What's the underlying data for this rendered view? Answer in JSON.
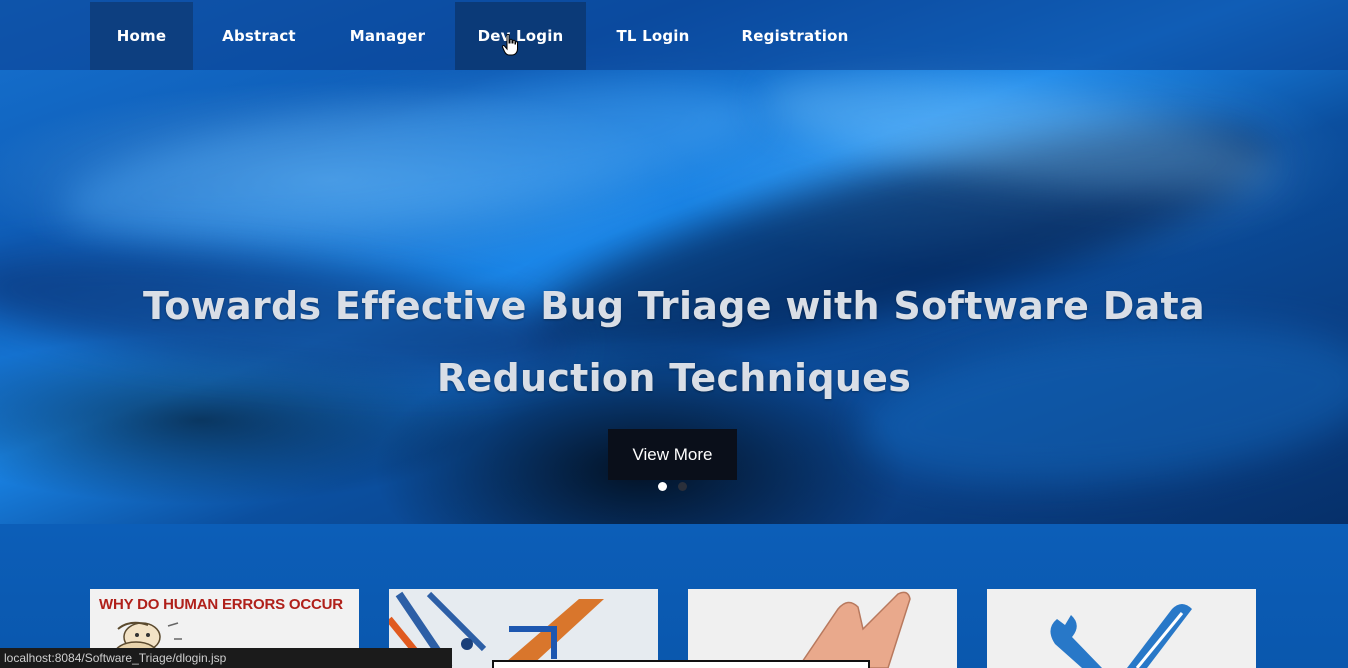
{
  "nav": {
    "items": [
      {
        "label": "Home"
      },
      {
        "label": "Abstract"
      },
      {
        "label": "Manager"
      },
      {
        "label": "Dev Login"
      },
      {
        "label": "TL Login"
      },
      {
        "label": "Registration"
      }
    ]
  },
  "hero": {
    "title": "Towards Effective Bug Triage with Software Data Reduction Techniques",
    "button_label": "View More",
    "slides": {
      "total": 2,
      "active": 1
    }
  },
  "cards": [
    {
      "caption": "WHY DO HUMAN ERRORS OCCUR"
    },
    {
      "caption": ""
    },
    {
      "caption": ""
    },
    {
      "caption": ""
    }
  ],
  "statusbar": {
    "url": "localhost:8084/Software_Triage/dlogin.jsp"
  },
  "colors": {
    "nav_active": "#0d3f80",
    "hero_blue": "#1672d0",
    "button_bg": "#0a0f1a",
    "card1_caption": "#b0201a"
  }
}
